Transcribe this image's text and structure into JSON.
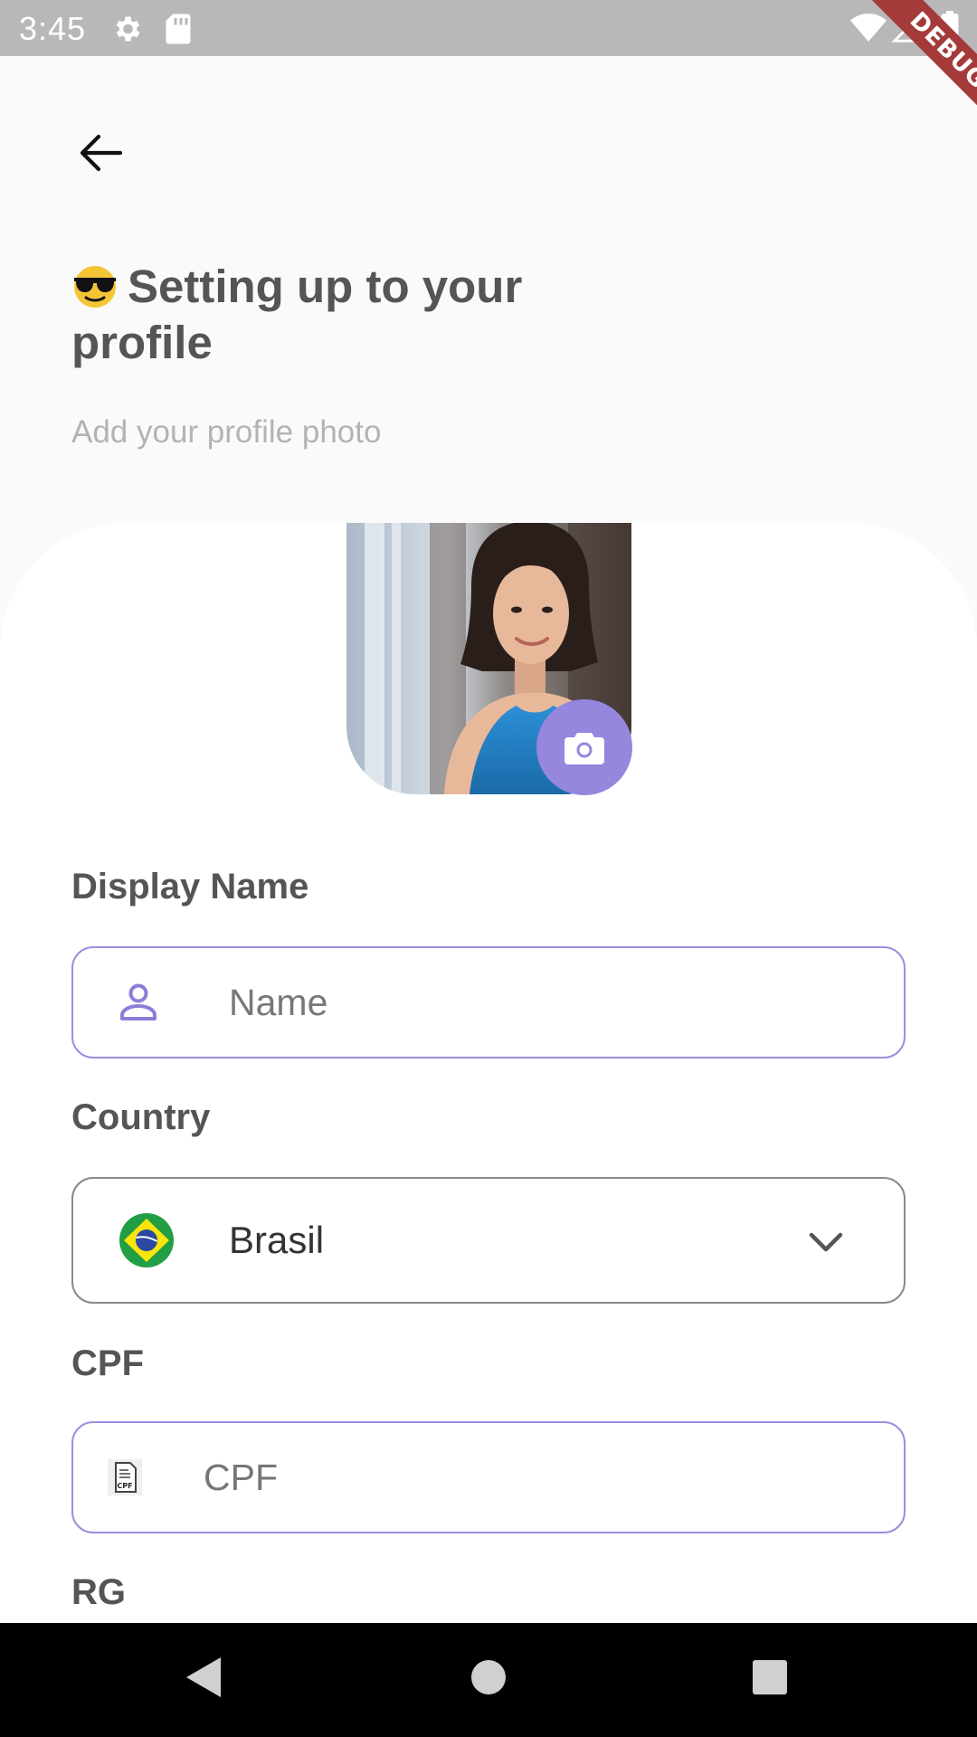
{
  "status_bar": {
    "time": "3:45",
    "icons": [
      "gear-icon",
      "sd-card-icon",
      "wifi-icon",
      "signal-icon",
      "battery-icon"
    ],
    "debug_label": "DEBUG"
  },
  "header": {
    "back_icon": "arrow-left-icon",
    "title_emoji": "😎",
    "title": "Setting up to your profile",
    "subtitle": "Add your profile photo"
  },
  "profile_photo": {
    "camera_icon": "camera-icon"
  },
  "form": {
    "display_name": {
      "label": "Display Name",
      "placeholder": "Name",
      "value": "",
      "icon": "person-icon"
    },
    "country": {
      "label": "Country",
      "value": "Brasil",
      "icon": "brazil-flag-icon",
      "dropdown_icon": "chevron-down-icon"
    },
    "cpf": {
      "label": "CPF",
      "placeholder": "CPF",
      "value": "",
      "icon": "cpf-document-icon",
      "icon_text": "CPF"
    },
    "rg": {
      "label": "RG"
    }
  },
  "navigation_bar": {
    "icons": [
      "back-triangle-icon",
      "home-circle-icon",
      "recents-square-icon"
    ]
  },
  "colors": {
    "accent": "#9586de",
    "field_border": "#9a8fdf",
    "background": "#fafafa",
    "card": "#ffffff",
    "status_bar": "#b8b8b8",
    "debug_ribbon": "#a43a3a"
  }
}
